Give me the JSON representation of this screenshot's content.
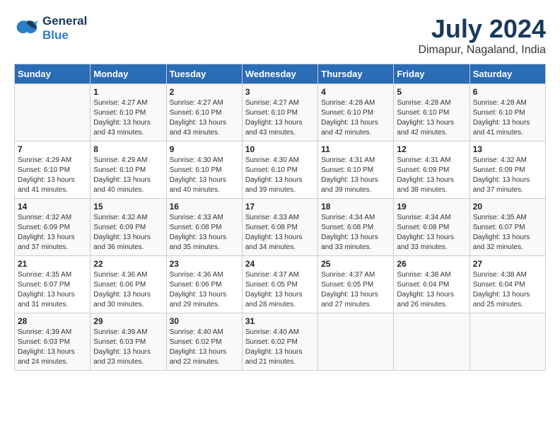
{
  "header": {
    "logo_line1": "General",
    "logo_line2": "Blue",
    "month_year": "July 2024",
    "location": "Dimapur, Nagaland, India"
  },
  "days_of_week": [
    "Sunday",
    "Monday",
    "Tuesday",
    "Wednesday",
    "Thursday",
    "Friday",
    "Saturday"
  ],
  "weeks": [
    [
      {
        "day": "",
        "content": ""
      },
      {
        "day": "1",
        "content": "Sunrise: 4:27 AM\nSunset: 6:10 PM\nDaylight: 13 hours\nand 43 minutes."
      },
      {
        "day": "2",
        "content": "Sunrise: 4:27 AM\nSunset: 6:10 PM\nDaylight: 13 hours\nand 43 minutes."
      },
      {
        "day": "3",
        "content": "Sunrise: 4:27 AM\nSunset: 6:10 PM\nDaylight: 13 hours\nand 43 minutes."
      },
      {
        "day": "4",
        "content": "Sunrise: 4:28 AM\nSunset: 6:10 PM\nDaylight: 13 hours\nand 42 minutes."
      },
      {
        "day": "5",
        "content": "Sunrise: 4:28 AM\nSunset: 6:10 PM\nDaylight: 13 hours\nand 42 minutes."
      },
      {
        "day": "6",
        "content": "Sunrise: 4:28 AM\nSunset: 6:10 PM\nDaylight: 13 hours\nand 41 minutes."
      }
    ],
    [
      {
        "day": "7",
        "content": "Sunrise: 4:29 AM\nSunset: 6:10 PM\nDaylight: 13 hours\nand 41 minutes."
      },
      {
        "day": "8",
        "content": "Sunrise: 4:29 AM\nSunset: 6:10 PM\nDaylight: 13 hours\nand 40 minutes."
      },
      {
        "day": "9",
        "content": "Sunrise: 4:30 AM\nSunset: 6:10 PM\nDaylight: 13 hours\nand 40 minutes."
      },
      {
        "day": "10",
        "content": "Sunrise: 4:30 AM\nSunset: 6:10 PM\nDaylight: 13 hours\nand 39 minutes."
      },
      {
        "day": "11",
        "content": "Sunrise: 4:31 AM\nSunset: 6:10 PM\nDaylight: 13 hours\nand 39 minutes."
      },
      {
        "day": "12",
        "content": "Sunrise: 4:31 AM\nSunset: 6:09 PM\nDaylight: 13 hours\nand 38 minutes."
      },
      {
        "day": "13",
        "content": "Sunrise: 4:32 AM\nSunset: 6:09 PM\nDaylight: 13 hours\nand 37 minutes."
      }
    ],
    [
      {
        "day": "14",
        "content": "Sunrise: 4:32 AM\nSunset: 6:09 PM\nDaylight: 13 hours\nand 37 minutes."
      },
      {
        "day": "15",
        "content": "Sunrise: 4:32 AM\nSunset: 6:09 PM\nDaylight: 13 hours\nand 36 minutes."
      },
      {
        "day": "16",
        "content": "Sunrise: 4:33 AM\nSunset: 6:08 PM\nDaylight: 13 hours\nand 35 minutes."
      },
      {
        "day": "17",
        "content": "Sunrise: 4:33 AM\nSunset: 6:08 PM\nDaylight: 13 hours\nand 34 minutes."
      },
      {
        "day": "18",
        "content": "Sunrise: 4:34 AM\nSunset: 6:08 PM\nDaylight: 13 hours\nand 33 minutes."
      },
      {
        "day": "19",
        "content": "Sunrise: 4:34 AM\nSunset: 6:08 PM\nDaylight: 13 hours\nand 33 minutes."
      },
      {
        "day": "20",
        "content": "Sunrise: 4:35 AM\nSunset: 6:07 PM\nDaylight: 13 hours\nand 32 minutes."
      }
    ],
    [
      {
        "day": "21",
        "content": "Sunrise: 4:35 AM\nSunset: 6:07 PM\nDaylight: 13 hours\nand 31 minutes."
      },
      {
        "day": "22",
        "content": "Sunrise: 4:36 AM\nSunset: 6:06 PM\nDaylight: 13 hours\nand 30 minutes."
      },
      {
        "day": "23",
        "content": "Sunrise: 4:36 AM\nSunset: 6:06 PM\nDaylight: 13 hours\nand 29 minutes."
      },
      {
        "day": "24",
        "content": "Sunrise: 4:37 AM\nSunset: 6:05 PM\nDaylight: 13 hours\nand 28 minutes."
      },
      {
        "day": "25",
        "content": "Sunrise: 4:37 AM\nSunset: 6:05 PM\nDaylight: 13 hours\nand 27 minutes."
      },
      {
        "day": "26",
        "content": "Sunrise: 4:38 AM\nSunset: 6:04 PM\nDaylight: 13 hours\nand 26 minutes."
      },
      {
        "day": "27",
        "content": "Sunrise: 4:38 AM\nSunset: 6:04 PM\nDaylight: 13 hours\nand 25 minutes."
      }
    ],
    [
      {
        "day": "28",
        "content": "Sunrise: 4:39 AM\nSunset: 6:03 PM\nDaylight: 13 hours\nand 24 minutes."
      },
      {
        "day": "29",
        "content": "Sunrise: 4:39 AM\nSunset: 6:03 PM\nDaylight: 13 hours\nand 23 minutes."
      },
      {
        "day": "30",
        "content": "Sunrise: 4:40 AM\nSunset: 6:02 PM\nDaylight: 13 hours\nand 22 minutes."
      },
      {
        "day": "31",
        "content": "Sunrise: 4:40 AM\nSunset: 6:02 PM\nDaylight: 13 hours\nand 21 minutes."
      },
      {
        "day": "",
        "content": ""
      },
      {
        "day": "",
        "content": ""
      },
      {
        "day": "",
        "content": ""
      }
    ]
  ]
}
